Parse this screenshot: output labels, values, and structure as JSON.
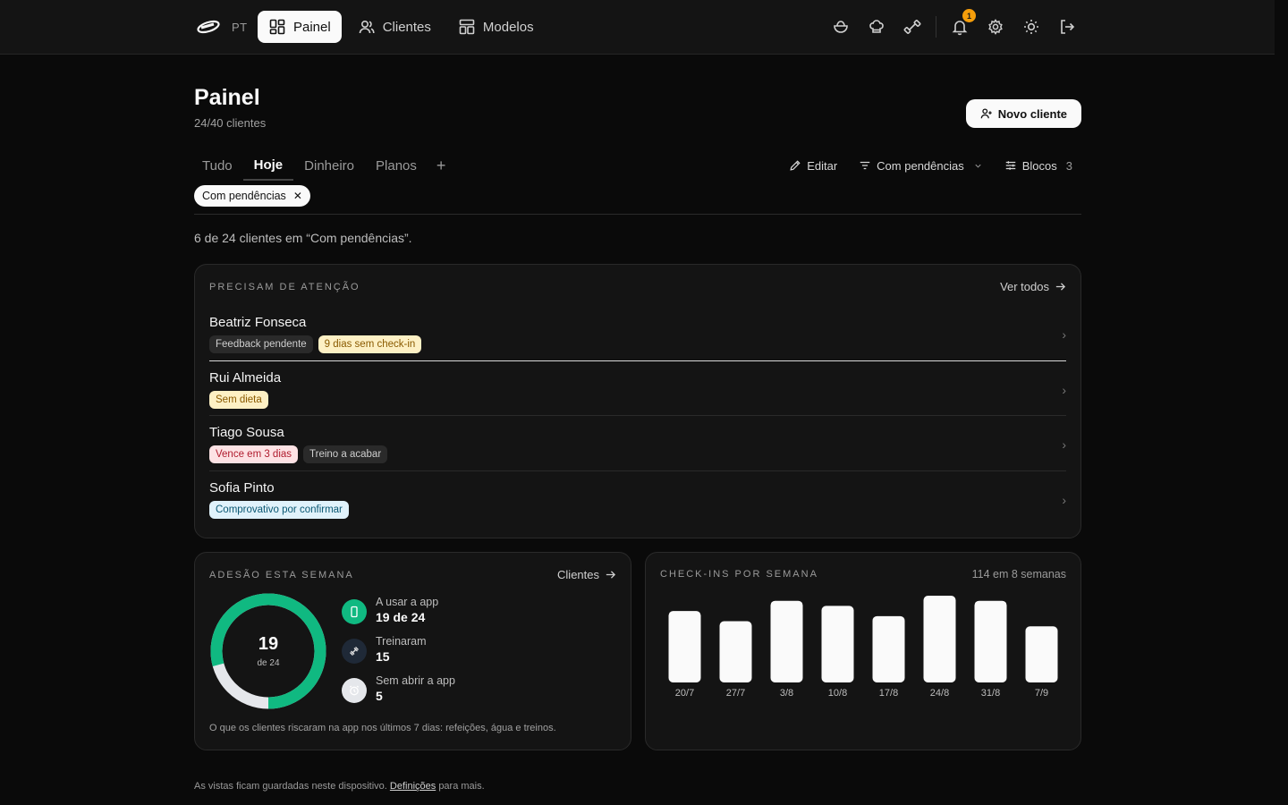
{
  "topbar": {
    "lang": "PT",
    "nav": [
      {
        "label": "Painel",
        "icon": "grid-icon",
        "active": true
      },
      {
        "label": "Clientes",
        "icon": "users-icon",
        "active": false
      },
      {
        "label": "Modelos",
        "icon": "layout-icon",
        "active": false
      }
    ],
    "notification_count": "1"
  },
  "header": {
    "title": "Painel",
    "subtitle": "24/40 clientes",
    "new_client_label": "Novo cliente"
  },
  "tabs": [
    {
      "label": "Tudo",
      "active": false
    },
    {
      "label": "Hoje",
      "active": true
    },
    {
      "label": "Dinheiro",
      "active": false
    },
    {
      "label": "Planos",
      "active": false
    }
  ],
  "toolbar": {
    "add_tab": "+",
    "edit_label": "Editar",
    "filter_label": "Com pendências",
    "blocks_label": "Blocos",
    "blocks_count": "3"
  },
  "active_filter": {
    "label": "Com pendências",
    "remove": "✕"
  },
  "result_text": "6 de 24 clientes em “Com pendências”.",
  "attention": {
    "label": "PRECISAM DE ATENÇÃO",
    "link": "Ver todos",
    "clients": [
      {
        "name": "Beatriz Fonseca",
        "tags": [
          {
            "text": "Feedback pendente",
            "tone": "neutral"
          },
          {
            "text": "9 dias sem check-in",
            "tone": "amber"
          }
        ]
      },
      {
        "name": "Rui Almeida",
        "tags": [
          {
            "text": "Sem dieta",
            "tone": "amber"
          }
        ]
      },
      {
        "name": "Tiago Sousa",
        "tags": [
          {
            "text": "Vence em 3 dias",
            "tone": "red"
          },
          {
            "text": "Treino a acabar",
            "tone": "neutral"
          }
        ]
      },
      {
        "name": "Sofia Pinto",
        "tags": [
          {
            "text": "Comprovativo por confirmar",
            "tone": "blue"
          }
        ]
      }
    ],
    "chevron": "›"
  },
  "adesao": {
    "label": "ADESÃO ESTA SEMANA",
    "link": "Clientes",
    "donut_value": "19",
    "donut_of": "de 24",
    "ratio": 0.7917,
    "stats": [
      {
        "label": "A usar a app",
        "value": "19 de 24",
        "icon": "phone-icon",
        "color": "#10b981"
      },
      {
        "label": "Treinaram",
        "value": "15",
        "icon": "dumbbell-icon",
        "color": "#1f2937"
      },
      {
        "label": "Sem abrir a app",
        "value": "5",
        "icon": "alarm-icon",
        "color": "#e5e7eb"
      }
    ],
    "note": "O que os clientes riscaram na app nos últimos 7 dias: refeições, água e treinos.",
    "colors": {
      "filled": "#10b981",
      "empty": "#e5e7eb"
    }
  },
  "checkins": {
    "label": "CHECK-INS POR SEMANA",
    "summary": "114 em 8 semanas"
  },
  "chart_data": {
    "type": "bar",
    "categories": [
      "20/7",
      "27/7",
      "3/8",
      "10/8",
      "17/8",
      "24/8",
      "31/8",
      "7/9"
    ],
    "values": [
      14,
      12,
      16,
      15,
      13,
      17,
      16,
      11
    ],
    "title": "CHECK-INS POR SEMANA",
    "xlabel": "",
    "ylabel": "",
    "ylim": [
      0,
      17
    ]
  },
  "footer": {
    "text_before": "As vistas ficam guardadas neste dispositivo.",
    "link": "Definições",
    "text_after": "para mais."
  }
}
